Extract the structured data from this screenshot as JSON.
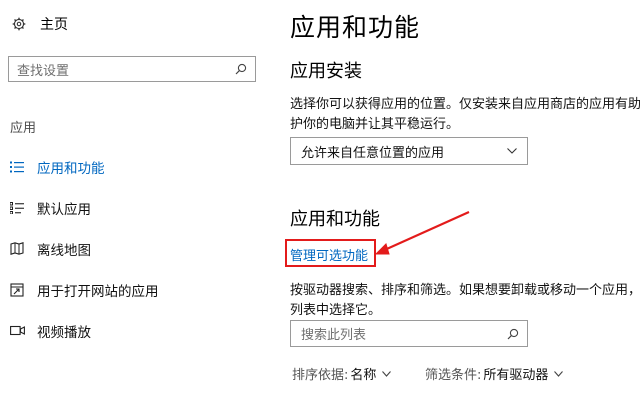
{
  "sidebar": {
    "home_label": "主页",
    "search_placeholder": "查找设置",
    "section_label": "应用",
    "items": [
      {
        "label": "应用和功能",
        "icon": "list-icon",
        "active": true
      },
      {
        "label": "默认应用",
        "icon": "default-apps-icon",
        "active": false
      },
      {
        "label": "离线地图",
        "icon": "map-icon",
        "active": false
      },
      {
        "label": "用于打开网站的应用",
        "icon": "open-in-app-icon",
        "active": false
      },
      {
        "label": "视频播放",
        "icon": "video-icon",
        "active": false
      }
    ]
  },
  "main": {
    "title": "应用和功能",
    "install_heading": "应用安装",
    "install_desc_line1": "选择你可以获得应用的位置。仅安装来自应用商店的应用有助于保",
    "install_desc_line2": "护你的电脑并让其平稳运行。",
    "install_dropdown_value": "允许来自任意位置的应用",
    "apps_heading": "应用和功能",
    "manage_link": "管理可选功能",
    "apps_desc_line1": "按驱动器搜索、排序和筛选。如果想要卸载或移动一个应用，请从",
    "apps_desc_line2": "列表中选择它。",
    "search_list_placeholder": "搜索此列表",
    "sort_label": "排序依据:",
    "sort_value": "名称",
    "filter_label": "筛选条件:",
    "filter_value": "所有驱动器"
  },
  "colors": {
    "accent": "#0067c0",
    "highlight_annotation": "#e31b1b"
  }
}
